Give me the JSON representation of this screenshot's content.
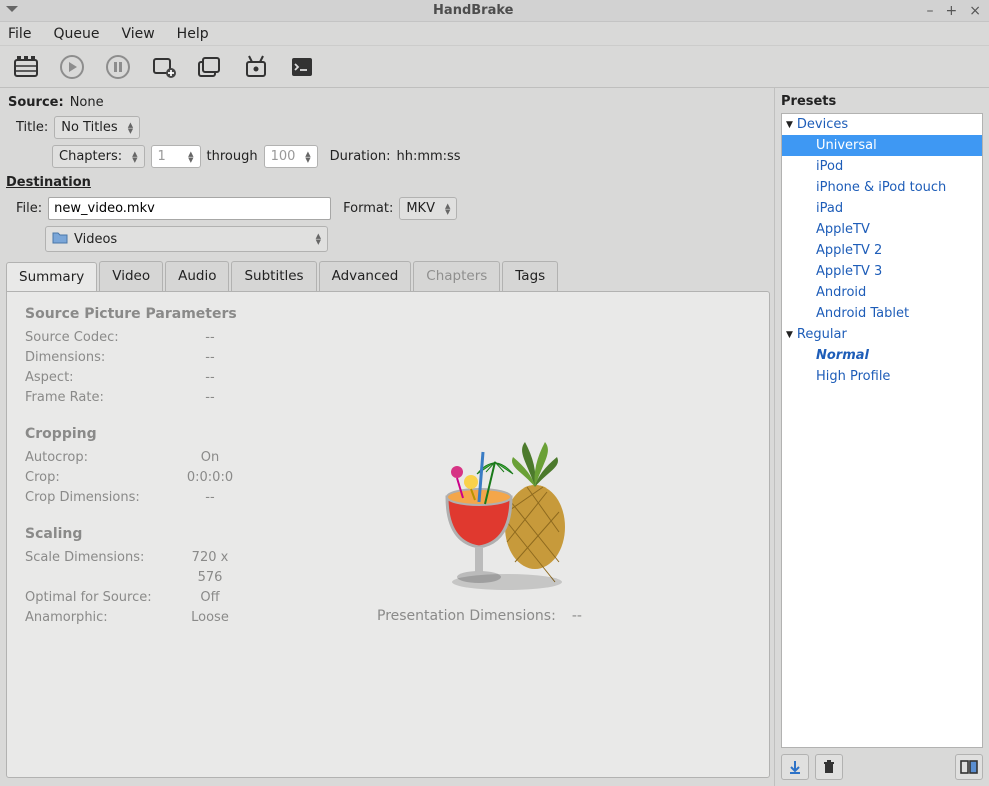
{
  "window": {
    "title": "HandBrake"
  },
  "menu": {
    "file": "File",
    "queue": "Queue",
    "view": "View",
    "help": "Help"
  },
  "source": {
    "label": "Source:",
    "value": "None",
    "title_label": "Title:",
    "title_select": "No Titles",
    "chapters_label": "Chapters:",
    "chapter_from": "1",
    "through_label": "through",
    "chapter_to": "100",
    "duration_label": "Duration:",
    "duration_value": "hh:mm:ss"
  },
  "destination": {
    "header": "Destination",
    "file_label": "File:",
    "file_value": "new_video.mkv",
    "format_label": "Format:",
    "format_value": "MKV",
    "folder_value": "Videos"
  },
  "tabs": {
    "summary": "Summary",
    "video": "Video",
    "audio": "Audio",
    "subtitles": "Subtitles",
    "advanced": "Advanced",
    "chapters": "Chapters",
    "tags": "Tags"
  },
  "summary": {
    "spp_title": "Source Picture Parameters",
    "source_codec_label": "Source Codec:",
    "source_codec_value": "--",
    "dimensions_label": "Dimensions:",
    "dimensions_value": "--",
    "aspect_label": "Aspect:",
    "aspect_value": "--",
    "framerate_label": "Frame Rate:",
    "framerate_value": "--",
    "cropping_title": "Cropping",
    "autocrop_label": "Autocrop:",
    "autocrop_value": "On",
    "crop_label": "Crop:",
    "crop_value": "0:0:0:0",
    "crop_dim_label": "Crop Dimensions:",
    "crop_dim_value": "--",
    "scaling_title": "Scaling",
    "scale_dim_label": "Scale Dimensions:",
    "scale_dim_value": "720 x 576",
    "optimal_label": "Optimal for Source:",
    "optimal_value": "Off",
    "anamorphic_label": "Anamorphic:",
    "anamorphic_value": "Loose",
    "presentation_label": "Presentation Dimensions:",
    "presentation_value": "--"
  },
  "presets": {
    "header": "Presets",
    "categories": [
      {
        "name": "Devices",
        "items": [
          "Universal",
          "iPod",
          "iPhone & iPod touch",
          "iPad",
          "AppleTV",
          "AppleTV 2",
          "AppleTV 3",
          "Android",
          "Android Tablet"
        ]
      },
      {
        "name": "Regular",
        "items": [
          "Normal",
          "High Profile"
        ]
      }
    ],
    "selected": "Universal",
    "default_item": "Normal"
  }
}
